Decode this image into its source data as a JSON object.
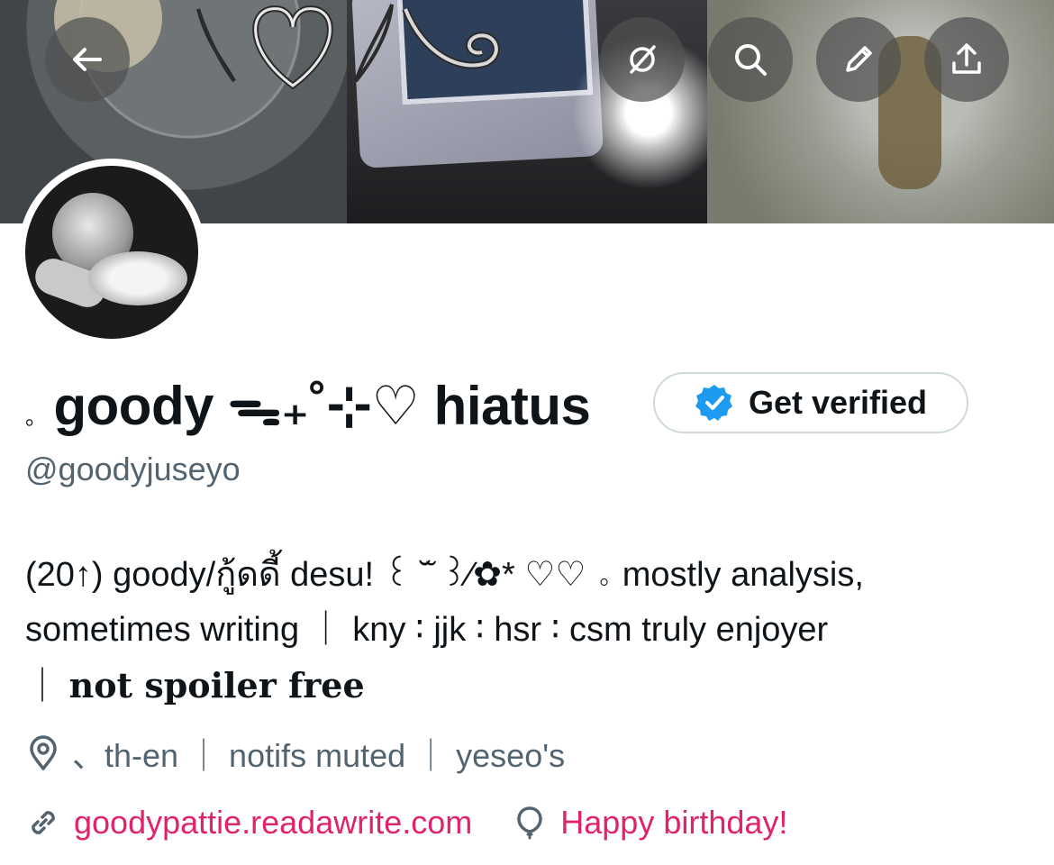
{
  "header": {
    "back_icon": "arrow-left-icon",
    "actions": [
      {
        "icon": "grok-slash-icon"
      },
      {
        "icon": "search-icon"
      },
      {
        "icon": "edit-pencil-icon"
      },
      {
        "icon": "share-upload-icon"
      }
    ]
  },
  "profile": {
    "name_prefix": "。",
    "display_name": "goody ᯓ₊˚⊹♡ hiatus",
    "verify_button_label": "Get verified",
    "handle": "@goodyjuseyo",
    "bio": {
      "line1": "(20↑) goody/กู้ดดี้ desu! ꒰ ˘̆ ꒱⁄✿* ♡♡ 。mostly analysis,",
      "line2": "sometimes writing ｜ kny ∶ jjk ∶ hsr ∶ csm truly enjoyer",
      "line3_prefix": "｜",
      "line3_bold": "not spoiler free"
    },
    "location": "、th-en ｜ notifs muted ｜ yeseo's",
    "website": "goodypattie.readawrite.com",
    "birthday_text": "Happy birthday!"
  },
  "colors": {
    "link": "#e0246c",
    "verified_badge": "#1d9bf0",
    "secondary_text": "#536471",
    "primary_text": "#0f1419"
  }
}
